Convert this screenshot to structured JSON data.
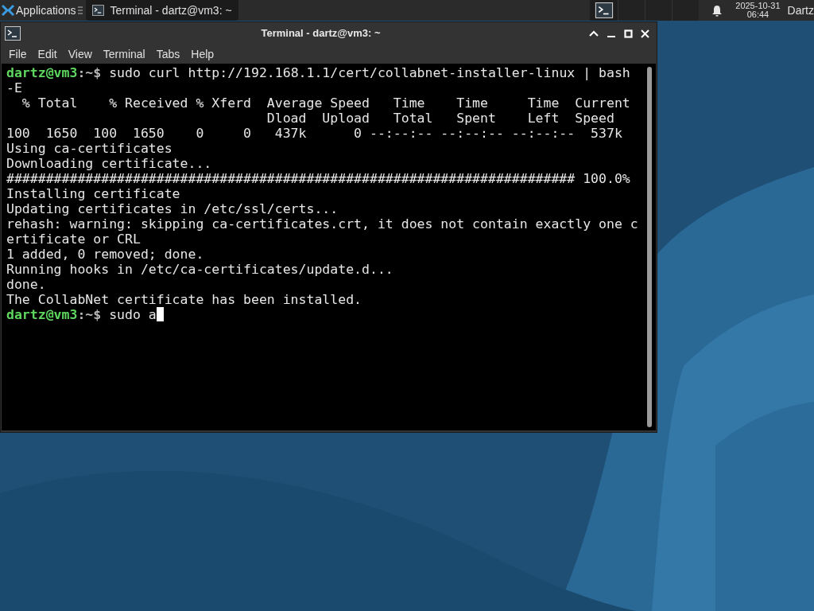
{
  "panel": {
    "apps_label": "Applications",
    "tasks": [
      {
        "label": "Terminal - dartz@vm3: ~",
        "selected": true
      }
    ],
    "date": "2025-10-31",
    "time": "06:44",
    "user": "Dartz"
  },
  "window": {
    "title": "Terminal - dartz@vm3: ~",
    "menu": [
      "File",
      "Edit",
      "View",
      "Terminal",
      "Tabs",
      "Help"
    ]
  },
  "terminal": {
    "lines": [
      {
        "kind": "prompt",
        "user": "dartz@vm3",
        "path": ":~$",
        "command": " sudo curl http://192.168.1.1/cert/collabnet-installer-linux | bash"
      },
      {
        "kind": "output",
        "text": "-E"
      },
      {
        "kind": "output",
        "text": "  % Total    % Received % Xferd  Average Speed   Time    Time     Time  Current"
      },
      {
        "kind": "output",
        "text": "                                 Dload  Upload   Total   Spent    Left  Speed"
      },
      {
        "kind": "output",
        "text": "100  1650  100  1650    0     0   437k      0 --:--:-- --:--:-- --:--:--  537k"
      },
      {
        "kind": "output",
        "text": "Using ca-certificates"
      },
      {
        "kind": "output",
        "text": "Downloading certificate..."
      },
      {
        "kind": "output",
        "text": "######################################################################## 100.0%"
      },
      {
        "kind": "output",
        "text": "Installing certificate"
      },
      {
        "kind": "output",
        "text": "Updating certificates in /etc/ssl/certs..."
      },
      {
        "kind": "output",
        "text": "rehash: warning: skipping ca-certificates.crt, it does not contain exactly one c"
      },
      {
        "kind": "output",
        "text": "ertificate or CRL"
      },
      {
        "kind": "output",
        "text": "1 added, 0 removed; done."
      },
      {
        "kind": "output",
        "text": "Running hooks in /etc/ca-certificates/update.d..."
      },
      {
        "kind": "output",
        "text": "done."
      },
      {
        "kind": "output",
        "text": "The CollabNet certificate has been installed."
      },
      {
        "kind": "prompt",
        "user": "dartz@vm3",
        "path": ":~$",
        "command": " sudo a",
        "cursor": true
      }
    ]
  }
}
